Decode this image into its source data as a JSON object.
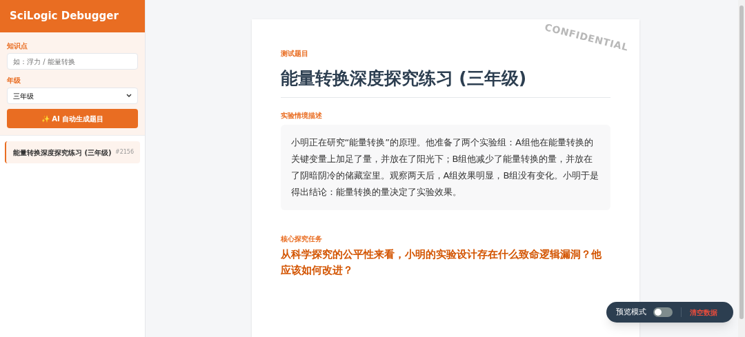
{
  "sidebar": {
    "title": "SciLogic Debugger",
    "topic": {
      "label": "知识点",
      "placeholder": "如：浮力 / 能量转换"
    },
    "grade": {
      "label": "年级",
      "value": "三年级"
    },
    "generate_button": "✨ AI 自动生成题目",
    "history": [
      {
        "title": "能量转换深度探究练习 (三年级)",
        "id": "#2156",
        "selected": true
      }
    ]
  },
  "paper": {
    "stamp": "CONFIDENTIAL",
    "eyebrow": "测试题目",
    "title": "能量转换深度探究练习 (三年级)",
    "scenario_label": "实验情境描述",
    "scenario": "小明正在研究“能量转换”的原理。他准备了两个实验组：A组他在能量转换的关键变量上加足了量，并放在了阳光下；B组他减少了能量转换的量，并放在了阴暗阴冷的储藏室里。观察两天后，A组效果明显，B组没有变化。小明于是得出结论：能量转换的量决定了实验效果。",
    "task_label": "核心探究任务",
    "task": "从科学探究的公平性来看，小明的实验设计存在什么致命逻辑漏洞？他应该如何改进？"
  },
  "toolbar": {
    "preview_label": "预览模式",
    "preview_on": false,
    "clear_button": "清空数据"
  }
}
